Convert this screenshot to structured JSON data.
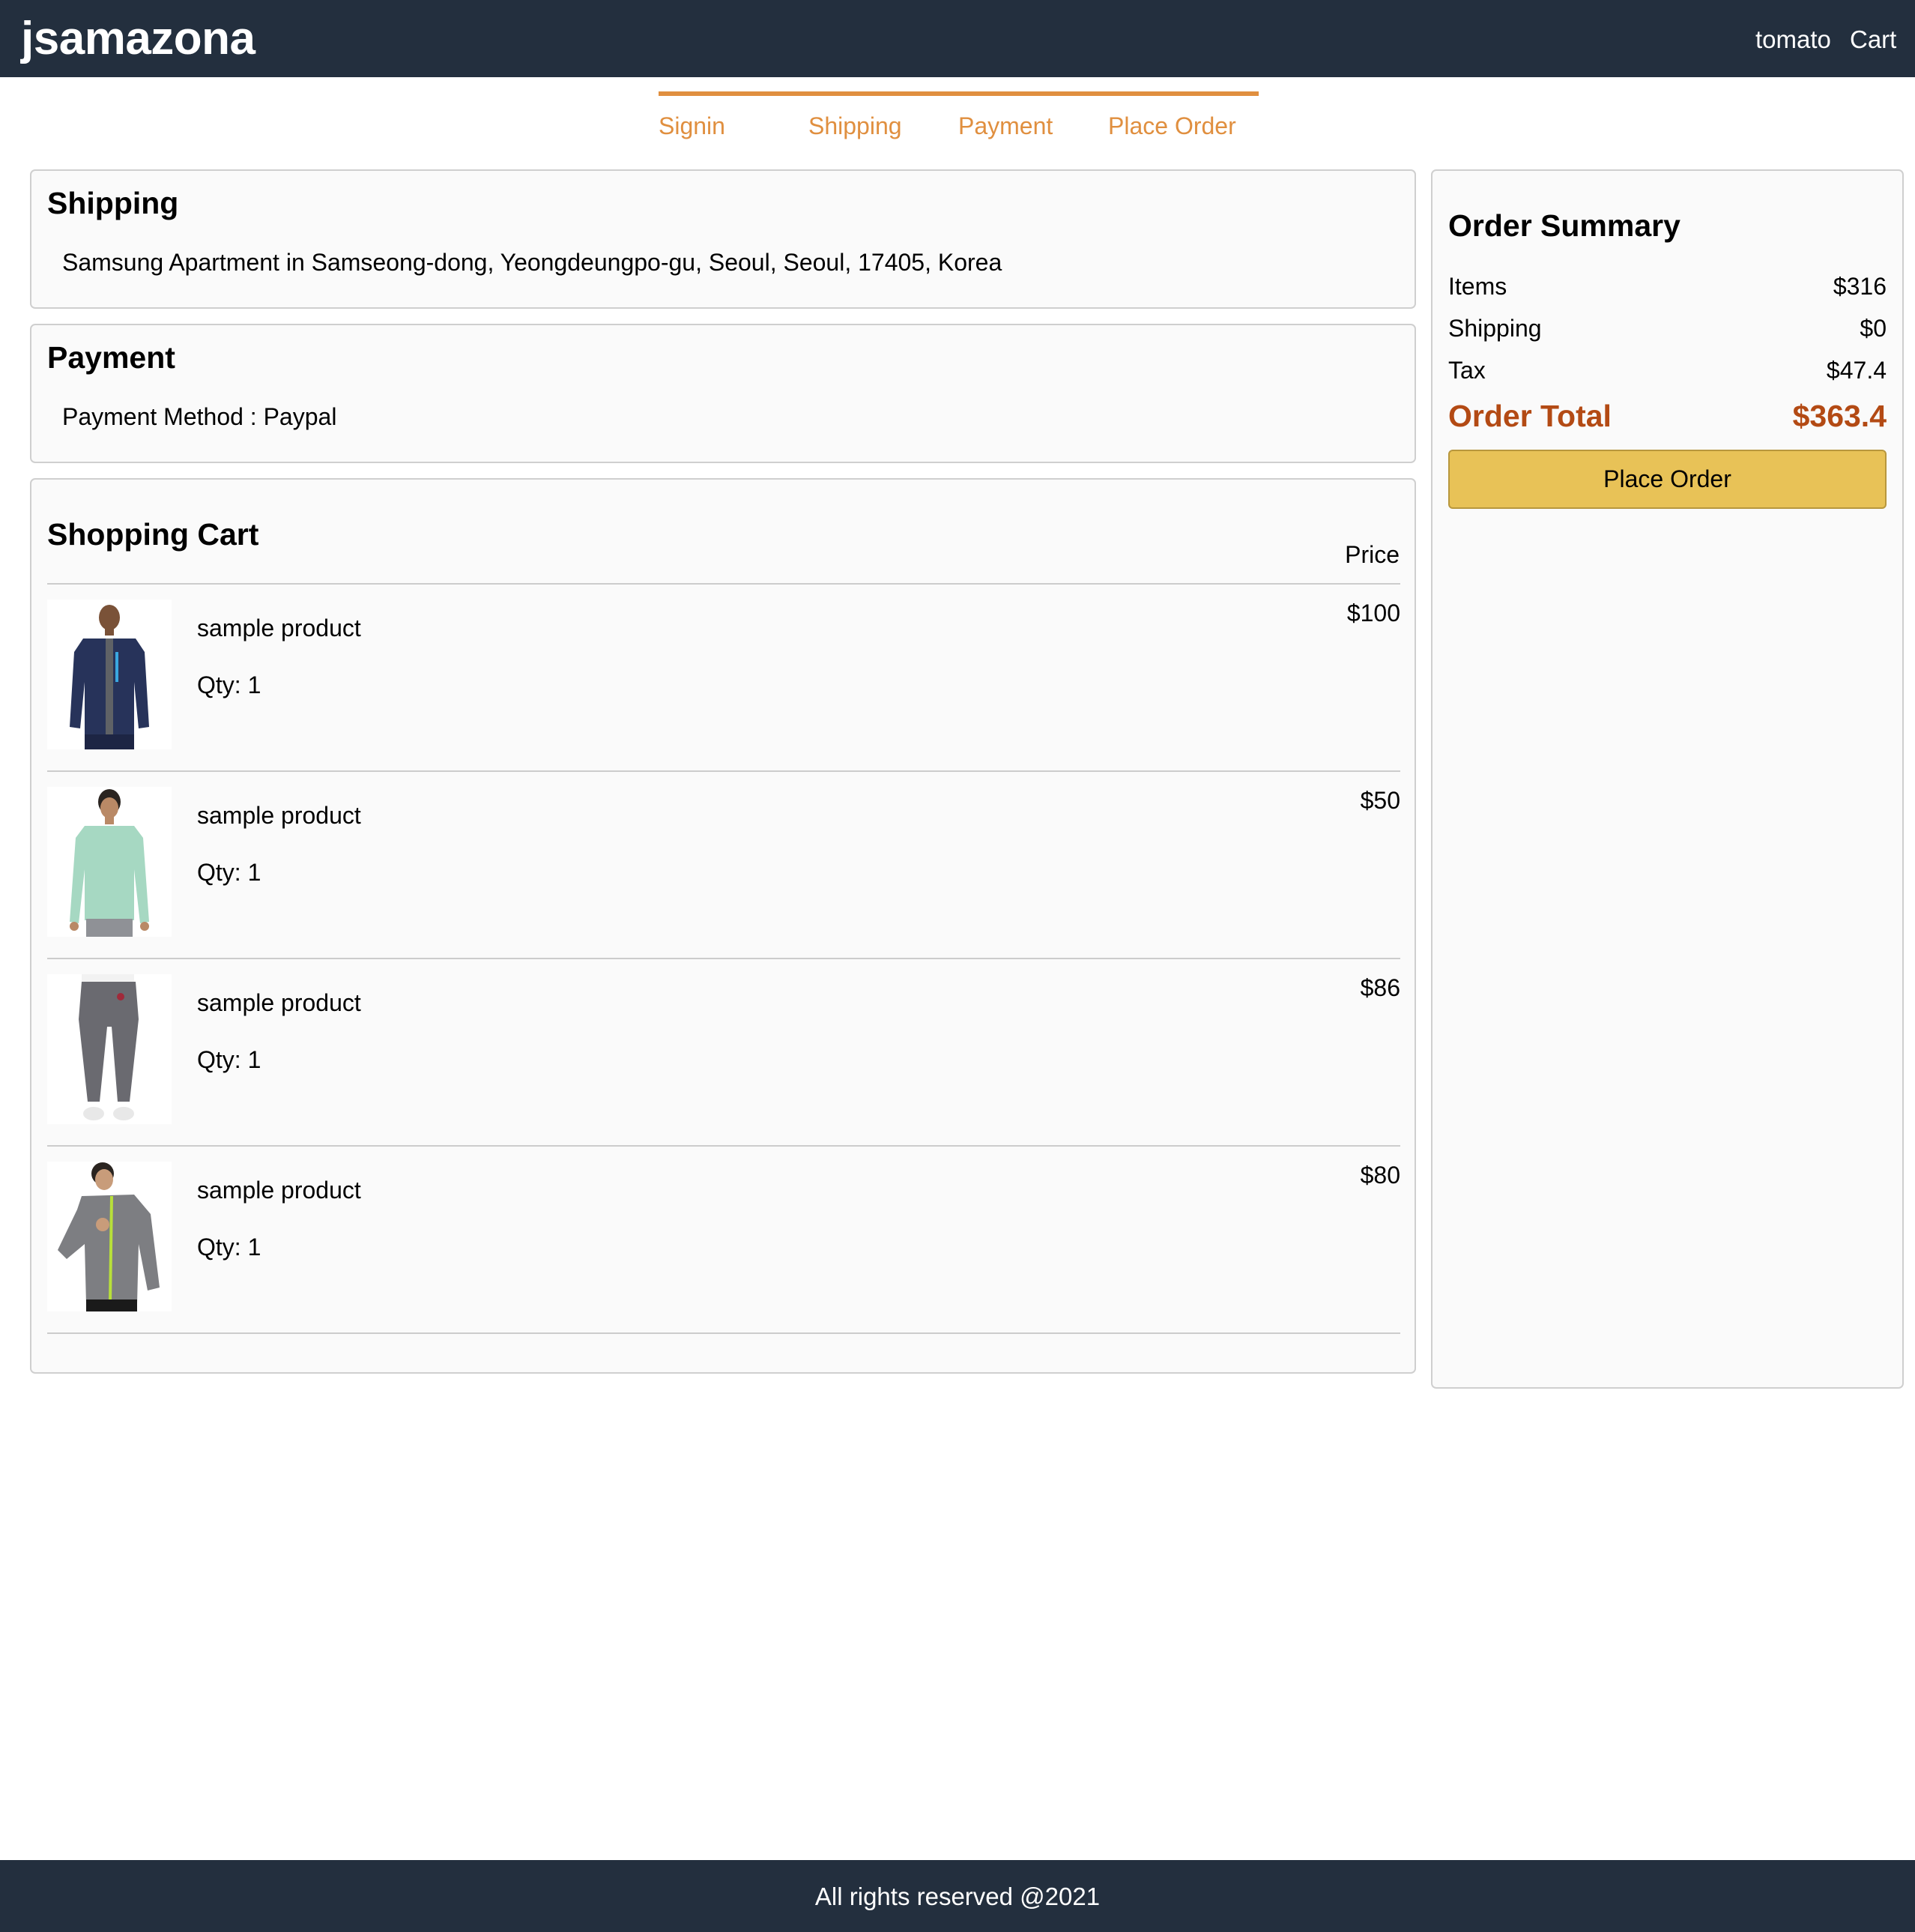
{
  "header": {
    "brand": "jsamazona",
    "user_label": "tomato",
    "cart_label": "Cart"
  },
  "steps": [
    {
      "label": "Signin",
      "active": true
    },
    {
      "label": "Shipping",
      "active": true
    },
    {
      "label": "Payment",
      "active": true
    },
    {
      "label": "Place Order",
      "active": true
    }
  ],
  "shipping": {
    "title": "Shipping",
    "address": "Samsung Apartment in Samseong-dong, Yeongdeungpo-gu, Seoul, Seoul, 17405, Korea"
  },
  "payment": {
    "title": "Payment",
    "method_text": "Payment Method : Paypal"
  },
  "cart": {
    "title": "Shopping Cart",
    "price_header": "Price",
    "items": [
      {
        "name": "sample product",
        "qty": "Qty: 1",
        "price": "$100",
        "image": "navy zip hoodie"
      },
      {
        "name": "sample product",
        "qty": "Qty: 1",
        "price": "$50",
        "image": "mint long sleeve shirt"
      },
      {
        "name": "sample product",
        "qty": "Qty: 1",
        "price": "$86",
        "image": "gray jogger pants"
      },
      {
        "name": "sample product",
        "qty": "Qty: 1",
        "price": "$80",
        "image": "gray zip jacket"
      }
    ]
  },
  "summary": {
    "title": "Order Summary",
    "items_label": "Items",
    "items_value": "$316",
    "shipping_label": "Shipping",
    "shipping_value": "$0",
    "tax_label": "Tax",
    "tax_value": "$47.4",
    "total_label": "Order Total",
    "total_value": "$363.4",
    "button_label": "Place Order"
  },
  "footer": {
    "text": "All rights reserved @2021"
  },
  "colors": {
    "header_bg": "#232f3e",
    "step_accent": "#e08f3f",
    "total_text": "#b34a14",
    "button_bg": "#e8c257"
  }
}
